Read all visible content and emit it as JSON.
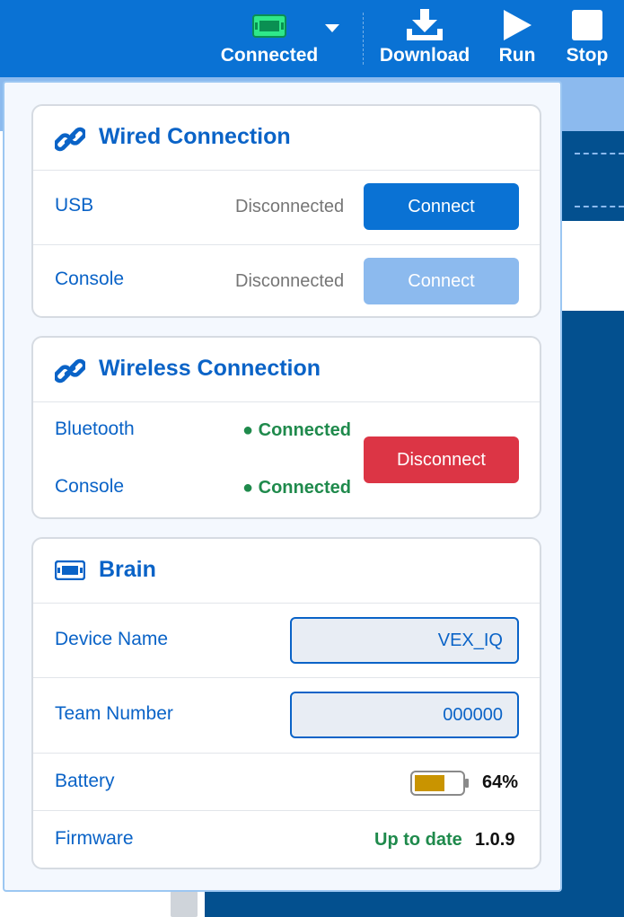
{
  "toolbar": {
    "connected_label": "Connected",
    "download_label": "Download",
    "run_label": "Run",
    "stop_label": "Stop",
    "accent": "#0a72d4",
    "device_icon_color": "#2ee88a"
  },
  "wired": {
    "title": "Wired Connection",
    "icon": "link-icon",
    "usb": {
      "label": "USB",
      "status": "Disconnected",
      "button": "Connect"
    },
    "console": {
      "label": "Console",
      "status": "Disconnected",
      "button": "Connect"
    }
  },
  "wireless": {
    "title": "Wireless Connection",
    "icon": "link-icon",
    "bluetooth": {
      "label": "Bluetooth",
      "status": "● Connected"
    },
    "console": {
      "label": "Console",
      "status": "● Connected"
    },
    "button": "Disconnect"
  },
  "brain": {
    "title": "Brain",
    "icon": "brain-device-icon",
    "device_name": {
      "label": "Device Name",
      "value": "VEX_IQ"
    },
    "team_number": {
      "label": "Team Number",
      "value": "000000"
    },
    "battery": {
      "label": "Battery",
      "percent_text": "64%",
      "level": 0.64,
      "color": "#c99400"
    },
    "firmware": {
      "label": "Firmware",
      "status": "Up to date",
      "version": "1.0.9"
    }
  },
  "colors": {
    "primary": "#0a63c7",
    "disconnect": "#dc3545",
    "connected_green": "#1f8a4c",
    "disabled_blue": "#8cbaee"
  }
}
